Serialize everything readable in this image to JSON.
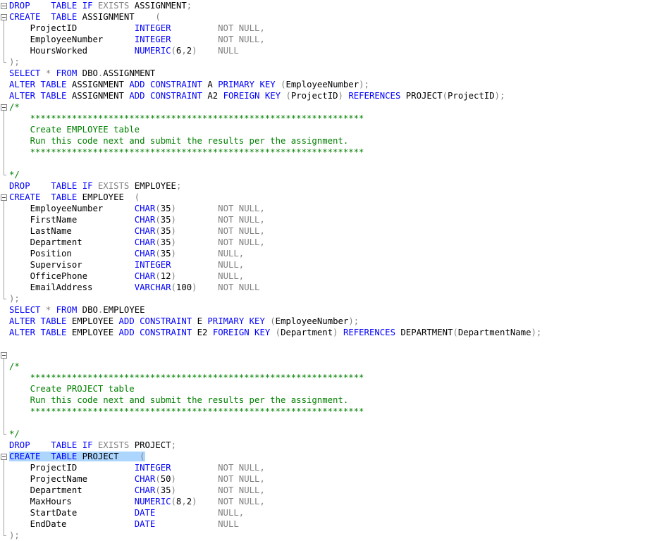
{
  "colors": {
    "keyword": "#0000ff",
    "operator": "#808080",
    "comment": "#008000",
    "selection": "#add6ff",
    "text": "#000000",
    "background": "#ffffff"
  },
  "lines": [
    [
      [
        "kw",
        "DROP"
      ],
      [
        "t",
        "    "
      ],
      [
        "kw",
        "TABLE"
      ],
      [
        "t",
        " "
      ],
      [
        "kw",
        "IF"
      ],
      [
        "t",
        " "
      ],
      [
        "gray",
        "EXISTS"
      ],
      [
        "t",
        " ASSIGNMENT"
      ],
      [
        "gray",
        ";"
      ]
    ],
    [
      [
        "kw",
        "CREATE"
      ],
      [
        "t",
        "  "
      ],
      [
        "kw",
        "TABLE"
      ],
      [
        "t",
        " ASSIGNMENT    "
      ],
      [
        "gray",
        "("
      ]
    ],
    [
      [
        "t",
        "    ProjectID           "
      ],
      [
        "kw",
        "INTEGER"
      ],
      [
        "t",
        "         "
      ],
      [
        "gray",
        "NOT NULL,"
      ]
    ],
    [
      [
        "t",
        "    EmployeeNumber      "
      ],
      [
        "kw",
        "INTEGER"
      ],
      [
        "t",
        "         "
      ],
      [
        "gray",
        "NOT NULL,"
      ]
    ],
    [
      [
        "t",
        "    HoursWorked         "
      ],
      [
        "kw",
        "NUMERIC"
      ],
      [
        "gray",
        "("
      ],
      [
        "t",
        "6"
      ],
      [
        "gray",
        ","
      ],
      [
        "t",
        "2"
      ],
      [
        "gray",
        ")"
      ],
      [
        "t",
        "    "
      ],
      [
        "gray",
        "NULL"
      ]
    ],
    [
      [
        "gray",
        ");"
      ]
    ],
    [
      [
        "kw",
        "SELECT"
      ],
      [
        "t",
        " "
      ],
      [
        "gray",
        "*"
      ],
      [
        "t",
        " "
      ],
      [
        "kw",
        "FROM"
      ],
      [
        "t",
        " DBO"
      ],
      [
        "gray",
        "."
      ],
      [
        "t",
        "ASSIGNMENT"
      ]
    ],
    [
      [
        "kw",
        "ALTER"
      ],
      [
        "t",
        " "
      ],
      [
        "kw",
        "TABLE"
      ],
      [
        "t",
        " ASSIGNMENT "
      ],
      [
        "kw",
        "ADD"
      ],
      [
        "t",
        " "
      ],
      [
        "kw",
        "CONSTRAINT"
      ],
      [
        "t",
        " A "
      ],
      [
        "kw",
        "PRIMARY"
      ],
      [
        "t",
        " "
      ],
      [
        "kw",
        "KEY"
      ],
      [
        "t",
        " "
      ],
      [
        "gray",
        "("
      ],
      [
        "t",
        "EmployeeNumber"
      ],
      [
        "gray",
        ");"
      ]
    ],
    [
      [
        "kw",
        "ALTER"
      ],
      [
        "t",
        " "
      ],
      [
        "kw",
        "TABLE"
      ],
      [
        "t",
        " ASSIGNMENT "
      ],
      [
        "kw",
        "ADD"
      ],
      [
        "t",
        " "
      ],
      [
        "kw",
        "CONSTRAINT"
      ],
      [
        "t",
        " A2 "
      ],
      [
        "kw",
        "FOREIGN"
      ],
      [
        "t",
        " "
      ],
      [
        "kw",
        "KEY"
      ],
      [
        "t",
        " "
      ],
      [
        "gray",
        "("
      ],
      [
        "t",
        "ProjectID"
      ],
      [
        "gray",
        ")"
      ],
      [
        "t",
        " "
      ],
      [
        "kw",
        "REFERENCES"
      ],
      [
        "t",
        " PROJECT"
      ],
      [
        "gray",
        "("
      ],
      [
        "t",
        "ProjectID"
      ],
      [
        "gray",
        ");"
      ]
    ],
    [
      [
        "cm",
        "/*"
      ]
    ],
    [
      [
        "cm",
        "    ****************************************************************"
      ]
    ],
    [
      [
        "cm",
        "    Create EMPLOYEE table"
      ]
    ],
    [
      [
        "cm",
        "    Run this code next and submit the results per the assignment."
      ]
    ],
    [
      [
        "cm",
        "    ****************************************************************"
      ]
    ],
    [
      [
        "cm",
        ""
      ]
    ],
    [
      [
        "cm",
        "*/"
      ]
    ],
    [
      [
        "kw",
        "DROP"
      ],
      [
        "t",
        "    "
      ],
      [
        "kw",
        "TABLE"
      ],
      [
        "t",
        " "
      ],
      [
        "kw",
        "IF"
      ],
      [
        "t",
        " "
      ],
      [
        "gray",
        "EXISTS"
      ],
      [
        "t",
        " EMPLOYEE"
      ],
      [
        "gray",
        ";"
      ]
    ],
    [
      [
        "kw",
        "CREATE"
      ],
      [
        "t",
        "  "
      ],
      [
        "kw",
        "TABLE"
      ],
      [
        "t",
        " EMPLOYEE  "
      ],
      [
        "gray",
        "("
      ]
    ],
    [
      [
        "t",
        "    EmployeeNumber      "
      ],
      [
        "kw",
        "CHAR"
      ],
      [
        "gray",
        "("
      ],
      [
        "t",
        "35"
      ],
      [
        "gray",
        ")"
      ],
      [
        "t",
        "        "
      ],
      [
        "gray",
        "NOT NULL,"
      ]
    ],
    [
      [
        "t",
        "    FirstName           "
      ],
      [
        "kw",
        "CHAR"
      ],
      [
        "gray",
        "("
      ],
      [
        "t",
        "35"
      ],
      [
        "gray",
        ")"
      ],
      [
        "t",
        "        "
      ],
      [
        "gray",
        "NOT NULL,"
      ]
    ],
    [
      [
        "t",
        "    LastName            "
      ],
      [
        "kw",
        "CHAR"
      ],
      [
        "gray",
        "("
      ],
      [
        "t",
        "35"
      ],
      [
        "gray",
        ")"
      ],
      [
        "t",
        "        "
      ],
      [
        "gray",
        "NOT NULL,"
      ]
    ],
    [
      [
        "t",
        "    Department          "
      ],
      [
        "kw",
        "CHAR"
      ],
      [
        "gray",
        "("
      ],
      [
        "t",
        "35"
      ],
      [
        "gray",
        ")"
      ],
      [
        "t",
        "        "
      ],
      [
        "gray",
        "NOT NULL,"
      ]
    ],
    [
      [
        "t",
        "    Position            "
      ],
      [
        "kw",
        "CHAR"
      ],
      [
        "gray",
        "("
      ],
      [
        "t",
        "35"
      ],
      [
        "gray",
        ")"
      ],
      [
        "t",
        "        "
      ],
      [
        "gray",
        "NULL,"
      ]
    ],
    [
      [
        "t",
        "    Supervisor          "
      ],
      [
        "kw",
        "INTEGER"
      ],
      [
        "t",
        "         "
      ],
      [
        "gray",
        "NULL,"
      ]
    ],
    [
      [
        "t",
        "    OfficePhone         "
      ],
      [
        "kw",
        "CHAR"
      ],
      [
        "gray",
        "("
      ],
      [
        "t",
        "12"
      ],
      [
        "gray",
        ")"
      ],
      [
        "t",
        "        "
      ],
      [
        "gray",
        "NULL,"
      ]
    ],
    [
      [
        "t",
        "    EmailAddress        "
      ],
      [
        "kw",
        "VARCHAR"
      ],
      [
        "gray",
        "("
      ],
      [
        "t",
        "100"
      ],
      [
        "gray",
        ")"
      ],
      [
        "t",
        "    "
      ],
      [
        "gray",
        "NOT NULL"
      ]
    ],
    [
      [
        "gray",
        ");"
      ]
    ],
    [
      [
        "kw",
        "SELECT"
      ],
      [
        "t",
        " "
      ],
      [
        "gray",
        "*"
      ],
      [
        "t",
        " "
      ],
      [
        "kw",
        "FROM"
      ],
      [
        "t",
        " DBO"
      ],
      [
        "gray",
        "."
      ],
      [
        "t",
        "EMPLOYEE"
      ]
    ],
    [
      [
        "kw",
        "ALTER"
      ],
      [
        "t",
        " "
      ],
      [
        "kw",
        "TABLE"
      ],
      [
        "t",
        " EMPLOYEE "
      ],
      [
        "kw",
        "ADD"
      ],
      [
        "t",
        " "
      ],
      [
        "kw",
        "CONSTRAINT"
      ],
      [
        "t",
        " E "
      ],
      [
        "kw",
        "PRIMARY"
      ],
      [
        "t",
        " "
      ],
      [
        "kw",
        "KEY"
      ],
      [
        "t",
        " "
      ],
      [
        "gray",
        "("
      ],
      [
        "t",
        "EmployeeNumber"
      ],
      [
        "gray",
        ");"
      ]
    ],
    [
      [
        "kw",
        "ALTER"
      ],
      [
        "t",
        " "
      ],
      [
        "kw",
        "TABLE"
      ],
      [
        "t",
        " EMPLOYEE "
      ],
      [
        "kw",
        "ADD"
      ],
      [
        "t",
        " "
      ],
      [
        "kw",
        "CONSTRAINT"
      ],
      [
        "t",
        " E2 "
      ],
      [
        "kw",
        "FOREIGN"
      ],
      [
        "t",
        " "
      ],
      [
        "kw",
        "KEY"
      ],
      [
        "t",
        " "
      ],
      [
        "gray",
        "("
      ],
      [
        "t",
        "Department"
      ],
      [
        "gray",
        ")"
      ],
      [
        "t",
        " "
      ],
      [
        "kw",
        "REFERENCES"
      ],
      [
        "t",
        " DEPARTMENT"
      ],
      [
        "gray",
        "("
      ],
      [
        "t",
        "DepartmentName"
      ],
      [
        "gray",
        ");"
      ]
    ],
    [
      [
        "t",
        ""
      ]
    ],
    [
      [
        "t",
        ""
      ]
    ],
    [
      [
        "cm",
        "/*"
      ]
    ],
    [
      [
        "cm",
        "    ****************************************************************"
      ]
    ],
    [
      [
        "cm",
        "    Create PROJECT table"
      ]
    ],
    [
      [
        "cm",
        "    Run this code next and submit the results per the assignment."
      ]
    ],
    [
      [
        "cm",
        "    ****************************************************************"
      ]
    ],
    [
      [
        "cm",
        ""
      ]
    ],
    [
      [
        "cm",
        "*/"
      ]
    ],
    [
      [
        "kw",
        "DROP"
      ],
      [
        "t",
        "    "
      ],
      [
        "kw",
        "TABLE"
      ],
      [
        "t",
        " "
      ],
      [
        "kw",
        "IF"
      ],
      [
        "t",
        " "
      ],
      [
        "gray",
        "EXISTS"
      ],
      [
        "t",
        " PROJECT"
      ],
      [
        "gray",
        ";"
      ]
    ],
    [
      [
        "hl-kw",
        "CREATE"
      ],
      [
        "hl",
        "  "
      ],
      [
        "hl-kw",
        "TABLE"
      ],
      [
        "hl",
        " PROJECT    "
      ],
      [
        "hl-gray",
        "("
      ]
    ],
    [
      [
        "t",
        "    ProjectID           "
      ],
      [
        "kw",
        "INTEGER"
      ],
      [
        "t",
        "         "
      ],
      [
        "gray",
        "NOT NULL,"
      ]
    ],
    [
      [
        "t",
        "    ProjectName         "
      ],
      [
        "kw",
        "CHAR"
      ],
      [
        "gray",
        "("
      ],
      [
        "t",
        "50"
      ],
      [
        "gray",
        ")"
      ],
      [
        "t",
        "        "
      ],
      [
        "gray",
        "NOT NULL,"
      ]
    ],
    [
      [
        "t",
        "    Department          "
      ],
      [
        "kw",
        "CHAR"
      ],
      [
        "gray",
        "("
      ],
      [
        "t",
        "35"
      ],
      [
        "gray",
        ")"
      ],
      [
        "t",
        "        "
      ],
      [
        "gray",
        "NOT NULL,"
      ]
    ],
    [
      [
        "t",
        "    MaxHours            "
      ],
      [
        "kw",
        "NUMERIC"
      ],
      [
        "gray",
        "("
      ],
      [
        "t",
        "8"
      ],
      [
        "gray",
        ","
      ],
      [
        "t",
        "2"
      ],
      [
        "gray",
        ")"
      ],
      [
        "t",
        "    "
      ],
      [
        "gray",
        "NOT NULL,"
      ]
    ],
    [
      [
        "t",
        "    StartDate           "
      ],
      [
        "kw",
        "DATE"
      ],
      [
        "t",
        "            "
      ],
      [
        "gray",
        "NULL,"
      ]
    ],
    [
      [
        "t",
        "    EndDate             "
      ],
      [
        "kw",
        "DATE"
      ],
      [
        "t",
        "            "
      ],
      [
        "gray",
        "NULL"
      ]
    ],
    [
      [
        "gray",
        ");"
      ]
    ]
  ],
  "folds": [
    {
      "start": 0,
      "end": 0,
      "type": "box"
    },
    {
      "start": 1,
      "end": 5,
      "type": "box"
    },
    {
      "start": 9,
      "end": 15,
      "type": "box"
    },
    {
      "start": 17,
      "end": 26,
      "type": "box"
    },
    {
      "start": 31,
      "end": 38,
      "type": "box"
    },
    {
      "start": 40,
      "end": 47,
      "type": "box"
    }
  ]
}
